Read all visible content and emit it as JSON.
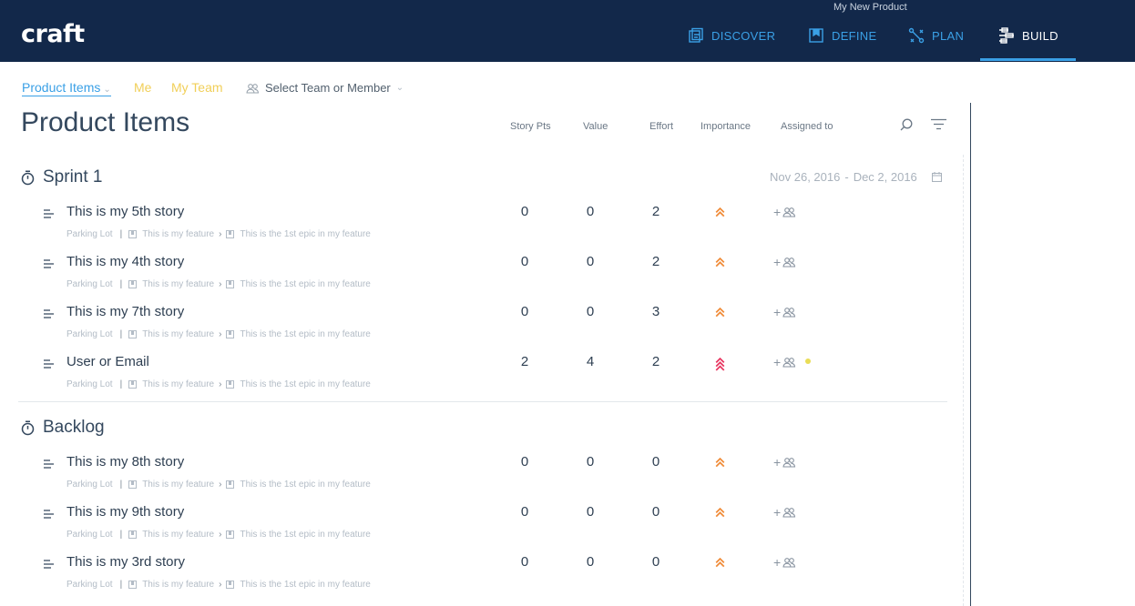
{
  "app": {
    "logo": "craft",
    "product_name": "My New Product"
  },
  "nav": {
    "tabs": [
      {
        "label": "DISCOVER",
        "icon": "discover-icon",
        "active": false
      },
      {
        "label": "DEFINE",
        "icon": "define-icon",
        "active": false
      },
      {
        "label": "PLAN",
        "icon": "plan-icon",
        "active": false
      },
      {
        "label": "BUILD",
        "icon": "build-icon",
        "active": true
      }
    ]
  },
  "subnav": {
    "product_items": "Product Items",
    "me": "Me",
    "my_team": "My Team",
    "select_team": "Select Team or Member"
  },
  "page": {
    "title": "Product Items",
    "columns": {
      "story_pts": "Story Pts",
      "value": "Value",
      "effort": "Effort",
      "importance": "Importance",
      "assigned_to": "Assigned to"
    }
  },
  "groups": [
    {
      "title": "Sprint 1",
      "date_start": "Nov 26, 2016",
      "date_sep": "-",
      "date_end": "Dec 2, 2016",
      "items": [
        {
          "name": "This is my 5th story",
          "story_pts": "0",
          "value": "0",
          "effort": "2",
          "importance": "high",
          "parking": "Parking Lot",
          "feature": "This is my feature",
          "epic": "This is the 1st epic in my feature",
          "assign": "+"
        },
        {
          "name": "This is my 4th story",
          "story_pts": "0",
          "value": "0",
          "effort": "2",
          "importance": "high",
          "parking": "Parking Lot",
          "feature": "This is my feature",
          "epic": "This is the 1st epic in my feature",
          "assign": "+"
        },
        {
          "name": "This is my 7th story",
          "story_pts": "0",
          "value": "0",
          "effort": "3",
          "importance": "high",
          "parking": "Parking Lot",
          "feature": "This is my feature",
          "epic": "This is the 1st epic in my feature",
          "assign": "+"
        },
        {
          "name": "User or Email",
          "story_pts": "2",
          "value": "4",
          "effort": "2",
          "importance": "critical",
          "parking": "Parking Lot",
          "feature": "This is my feature",
          "epic": "This is the 1st epic in my feature",
          "assign": "+"
        }
      ]
    },
    {
      "title": "Backlog",
      "items": [
        {
          "name": "This is my 8th story",
          "story_pts": "0",
          "value": "0",
          "effort": "0",
          "importance": "high",
          "parking": "Parking Lot",
          "feature": "This is my feature",
          "epic": "This is the 1st epic in my feature",
          "assign": "+"
        },
        {
          "name": "This is my 9th story",
          "story_pts": "0",
          "value": "0",
          "effort": "0",
          "importance": "high",
          "parking": "Parking Lot",
          "feature": "This is my feature",
          "epic": "This is the 1st epic in my feature",
          "assign": "+"
        },
        {
          "name": "This is my 3rd story",
          "story_pts": "0",
          "value": "0",
          "effort": "0",
          "importance": "high",
          "parking": "Parking Lot",
          "feature": "This is my feature",
          "epic": "This is the 1st epic in my feature",
          "assign": "+"
        }
      ]
    }
  ],
  "colors": {
    "topbar": "#12284a",
    "accent": "#3aa0e6",
    "importance_high": "#f08a36",
    "importance_critical": "#e8345f",
    "team_yellow": "#f1cf58"
  }
}
